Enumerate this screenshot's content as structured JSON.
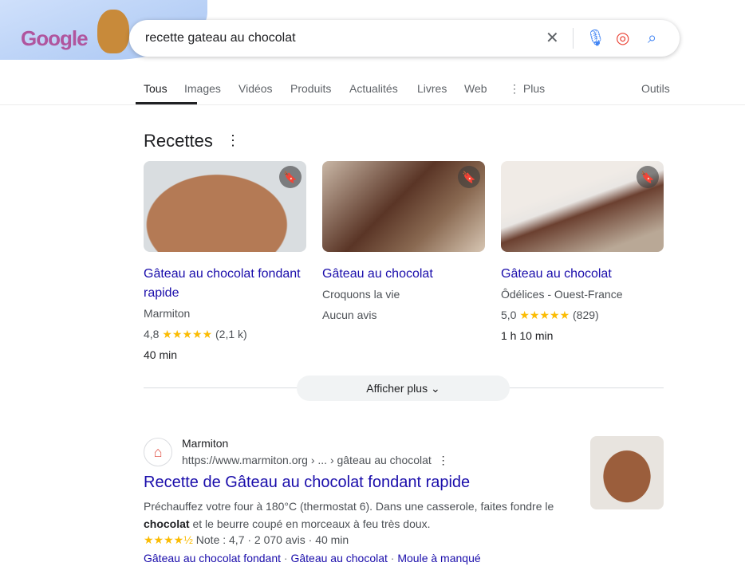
{
  "header": {
    "logo_text": "Google",
    "query": "recette gateau au chocolat"
  },
  "tabs": [
    {
      "label": "Tous"
    },
    {
      "label": "Images"
    },
    {
      "label": "Vidéos"
    },
    {
      "label": "Produits"
    },
    {
      "label": "Actualités"
    },
    {
      "label": "Livres"
    },
    {
      "label": "Web"
    },
    {
      "label": "Plus"
    }
  ],
  "tools_label": "Outils",
  "recipes": {
    "title": "Recettes",
    "cards": [
      {
        "title": "Gâteau au chocolat fondant rapide",
        "source": "Marmiton",
        "rating": "4,8",
        "stars": "★★★★★",
        "reviews": "(2,1 k)",
        "time": "40 min",
        "color": "#b47a55"
      },
      {
        "title": "Gâteau au chocolat",
        "source": "Croquons la vie",
        "rating_text": "Aucun avis",
        "color": "#5a3526"
      },
      {
        "title": "Gâteau au chocolat",
        "source": "Ôdélices - Ouest-France",
        "rating": "5,0",
        "stars": "★★★★★",
        "reviews": "(829)",
        "time": "1 h 10 min",
        "color": "#6b4030"
      }
    ],
    "more_label": "Afficher plus"
  },
  "result": {
    "site": "Marmiton",
    "url": "https://www.marmiton.org › ... › gâteau au chocolat",
    "title": "Recette de Gâteau au chocolat fondant rapide",
    "snippet_1": "Préchauffez votre four à 180°C (thermostat 6). Dans une casserole, faites fondre le ",
    "snippet_bold": "chocolat",
    "snippet_2": " et le beurre coupé en morceaux à feu très doux.",
    "stars": "★★★★½",
    "rating": "Note : 4,7 · 2 070 avis · 40 min",
    "links": [
      "Gâteau au chocolat fondant",
      "Gâteau au chocolat",
      "Moule à manqué"
    ]
  },
  "colors": {
    "link": "#1a0dab",
    "star": "#fbbc04"
  }
}
